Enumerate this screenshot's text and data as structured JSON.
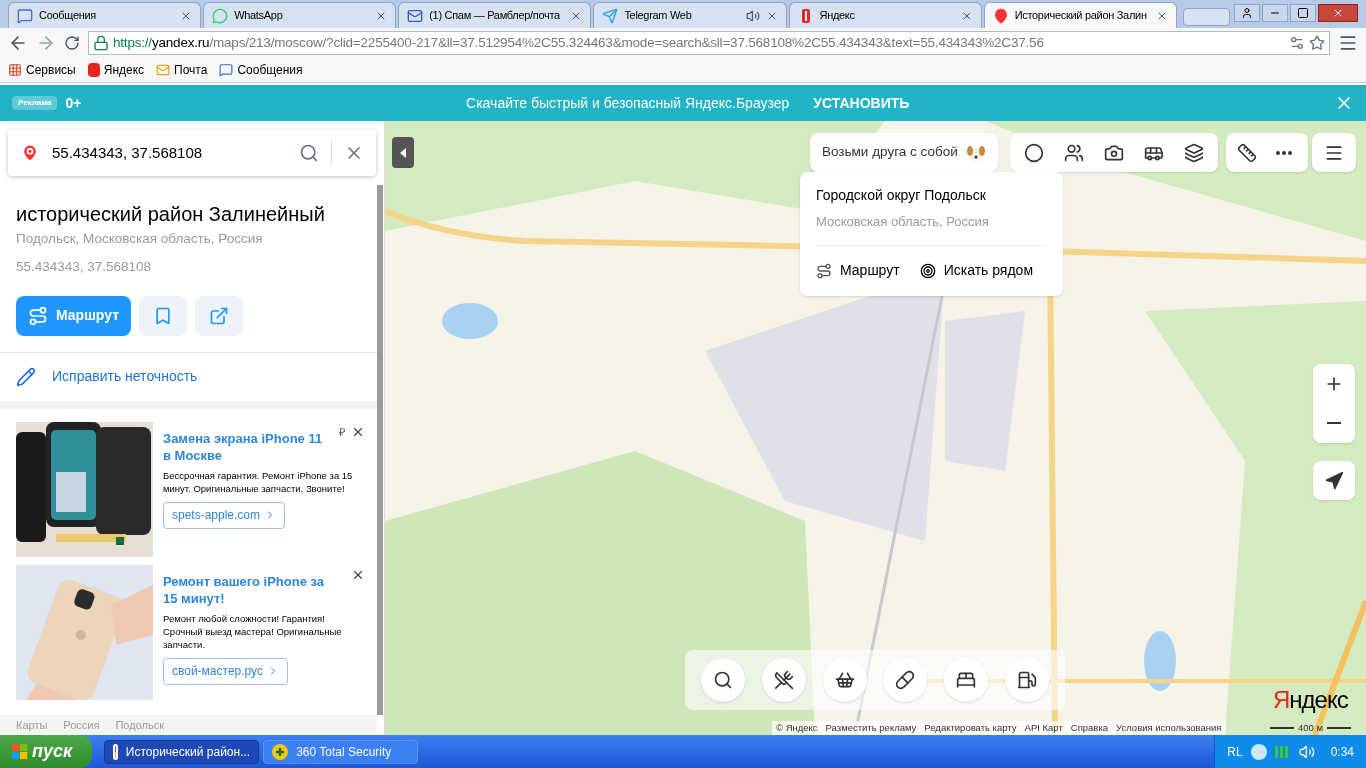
{
  "browser": {
    "tabs": [
      {
        "title": "Сообщения",
        "selected": false,
        "playing_audio": false
      },
      {
        "title": "WhatsApp",
        "selected": false,
        "playing_audio": false
      },
      {
        "title": "(1) Спам — Рамблер/почта",
        "selected": false,
        "playing_audio": false
      },
      {
        "title": "Telegram Web",
        "selected": false,
        "playing_audio": true
      },
      {
        "title": "Яндекс",
        "selected": false,
        "playing_audio": false
      },
      {
        "title": "Исторический район Залин",
        "selected": true,
        "playing_audio": false
      }
    ],
    "address": {
      "scheme": "https://",
      "host": "yandex.ru",
      "path": "/maps/213/moscow/?clid=2255400-217&ll=37.512954%2C55.324463&mode=search&sll=37.568108%2C55.434343&text=55.434343%2C37.56"
    },
    "bookmarks": [
      "Сервисы",
      "Яндекс",
      "Почта",
      "Сообщения"
    ]
  },
  "banner": {
    "badge": "Реклама",
    "age": "0+",
    "text": "Скачайте быстрый и безопасный Яндекс.Браузер",
    "action": "УСТАНОВИТЬ"
  },
  "sidebar": {
    "search": {
      "value": "55.434343, 37.568108"
    },
    "place": {
      "title": "исторический район Залинейный",
      "subtitle": "Подольск, Московская область, Россия",
      "coords": "55.434343, 37.568108"
    },
    "route_button": "Маршрут",
    "fix_link": "Исправить неточность",
    "ads": [
      {
        "title": "Замена экрана iPhone 11 в Москве",
        "text": "Бессрочная гарантия. Ремонт iPhone за 15 минут. Оригинальные запчасти. Звоните!",
        "link": "spets-apple.com",
        "badge": "₽"
      },
      {
        "title": "Ремонт вашего iPhone за 15 минут!",
        "text": "Ремонт любой сложности! Гарантия! Срочный выезд мастера! Оригинальные запчасти.",
        "link": "свой-мастер.рус"
      }
    ],
    "breadcrumbs": [
      "Карты",
      "Россия",
      "Подольск"
    ]
  },
  "map": {
    "promo": "Возьми друга с собой",
    "popup": {
      "title": "Городской округ Подольск",
      "subtitle": "Московская область, Россия",
      "actions": [
        "Маршрут",
        "Искать рядом"
      ]
    },
    "logo": "Яндекс",
    "footer": [
      "© Яндекс",
      "Разместить рекламу",
      "Редактировать карту",
      "API Карт",
      "Справка",
      "Условия использования"
    ],
    "scale": "400 м"
  },
  "taskbar": {
    "start": "пуск",
    "tasks": [
      {
        "title": "Исторический район...",
        "selected": true
      },
      {
        "title": "360 Total Security",
        "selected": false
      }
    ],
    "language": "RL",
    "clock": "0:34"
  }
}
